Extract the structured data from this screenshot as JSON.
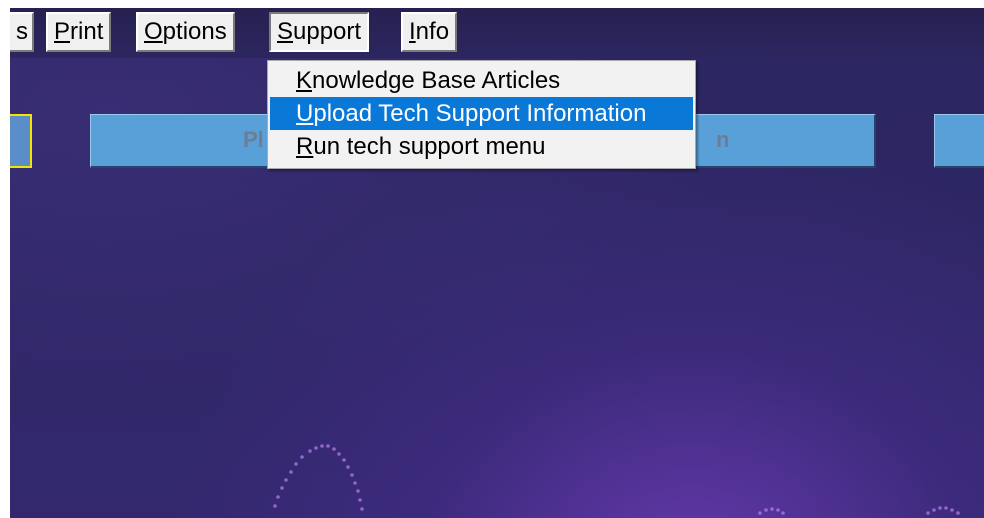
{
  "menubar": {
    "items": [
      {
        "label_u": "",
        "label_rest": "s",
        "name": "menu-partial-s"
      },
      {
        "label_u": "P",
        "label_rest": "rint",
        "name": "menu-print"
      },
      {
        "label_u": "O",
        "label_rest": "ptions",
        "name": "menu-options"
      },
      {
        "label_u": "S",
        "label_rest": "upport",
        "name": "menu-support"
      },
      {
        "label_u": "I",
        "label_rest": "nfo",
        "name": "menu-info"
      }
    ]
  },
  "support_menu": {
    "items": [
      {
        "u": "K",
        "rest": "nowledge Base Articles"
      },
      {
        "u": "U",
        "rest": "pload Tech Support Information"
      },
      {
        "u": "R",
        "rest": "un tech support menu"
      }
    ],
    "highlighted_index": 1
  },
  "main_buttons": {
    "center_left_text": "Pl",
    "center_right_text": "n"
  },
  "colors": {
    "highlight": "#0a78d7",
    "button_blue": "#5aa0d8",
    "selection_border": "#f2e600",
    "background": "#2e2765"
  }
}
